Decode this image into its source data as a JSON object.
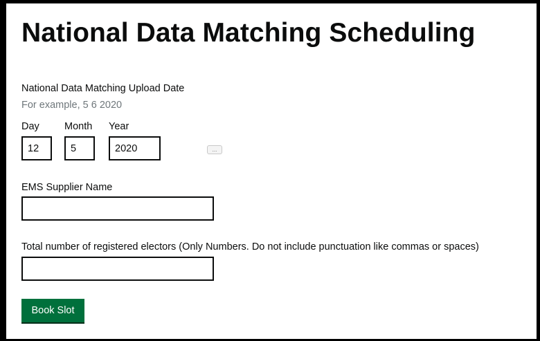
{
  "page": {
    "title": "National Data Matching Scheduling"
  },
  "upload_date": {
    "label": "National Data Matching Upload Date",
    "hint": "For example, 5 6 2020",
    "day": {
      "label": "Day",
      "value": "12"
    },
    "month": {
      "label": "Month",
      "value": "5"
    },
    "year": {
      "label": "Year",
      "value": "2020"
    },
    "picker_label": "..."
  },
  "ems_supplier": {
    "label": "EMS Supplier Name",
    "value": ""
  },
  "electors": {
    "label": "Total number of registered electors (Only Numbers. Do not include punctuation like commas or spaces)",
    "value": ""
  },
  "submit": {
    "label": "Book Slot"
  },
  "colors": {
    "button": "#00703c",
    "hint": "#6f777b",
    "text": "#0b0c0c",
    "border": "#000000"
  }
}
